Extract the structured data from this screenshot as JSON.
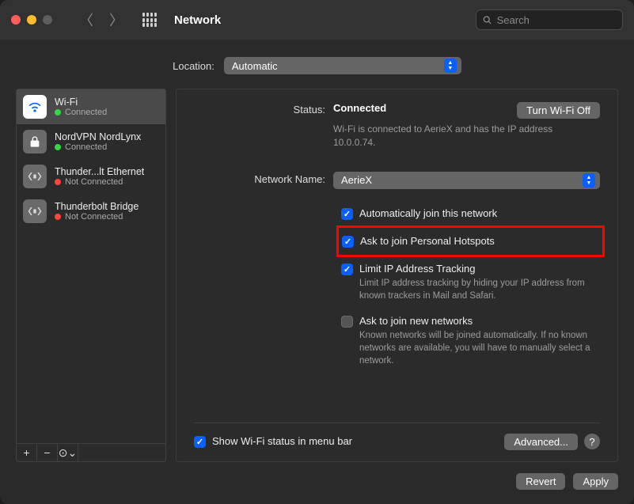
{
  "titlebar": {
    "title": "Network",
    "search_placeholder": "Search"
  },
  "location": {
    "label": "Location:",
    "value": "Automatic"
  },
  "sidebar": {
    "items": [
      {
        "name": "Wi-Fi",
        "status": "Connected",
        "dot": "green",
        "icon": "wifi",
        "selected": true
      },
      {
        "name": "NordVPN NordLynx",
        "status": "Connected",
        "dot": "green",
        "icon": "lock",
        "selected": false
      },
      {
        "name": "Thunder...lt Ethernet",
        "status": "Not Connected",
        "dot": "red",
        "icon": "eth",
        "selected": false
      },
      {
        "name": "Thunderbolt Bridge",
        "status": "Not Connected",
        "dot": "red",
        "icon": "eth",
        "selected": false
      }
    ]
  },
  "main": {
    "status_label": "Status:",
    "status_value": "Connected",
    "turn_off_label": "Turn Wi-Fi Off",
    "status_desc": "Wi-Fi is connected to AerieX and has the IP address 10.0.0.74.",
    "network_name_label": "Network Name:",
    "network_name_value": "AerieX",
    "checkboxes": {
      "auto_join": {
        "label": "Automatically join this network",
        "checked": true
      },
      "ask_hotspot": {
        "label": "Ask to join Personal Hotspots",
        "checked": true,
        "highlighted": true
      },
      "limit_tracking": {
        "label": "Limit IP Address Tracking",
        "checked": true,
        "desc": "Limit IP address tracking by hiding your IP address from known trackers in Mail and Safari."
      },
      "ask_new": {
        "label": "Ask to join new networks",
        "checked": false,
        "desc": "Known networks will be joined automatically. If no known networks are available, you will have to manually select a network."
      }
    },
    "show_menubar": {
      "label": "Show Wi-Fi status in menu bar",
      "checked": true
    },
    "advanced_label": "Advanced...",
    "help_label": "?"
  },
  "footer": {
    "revert": "Revert",
    "apply": "Apply"
  }
}
